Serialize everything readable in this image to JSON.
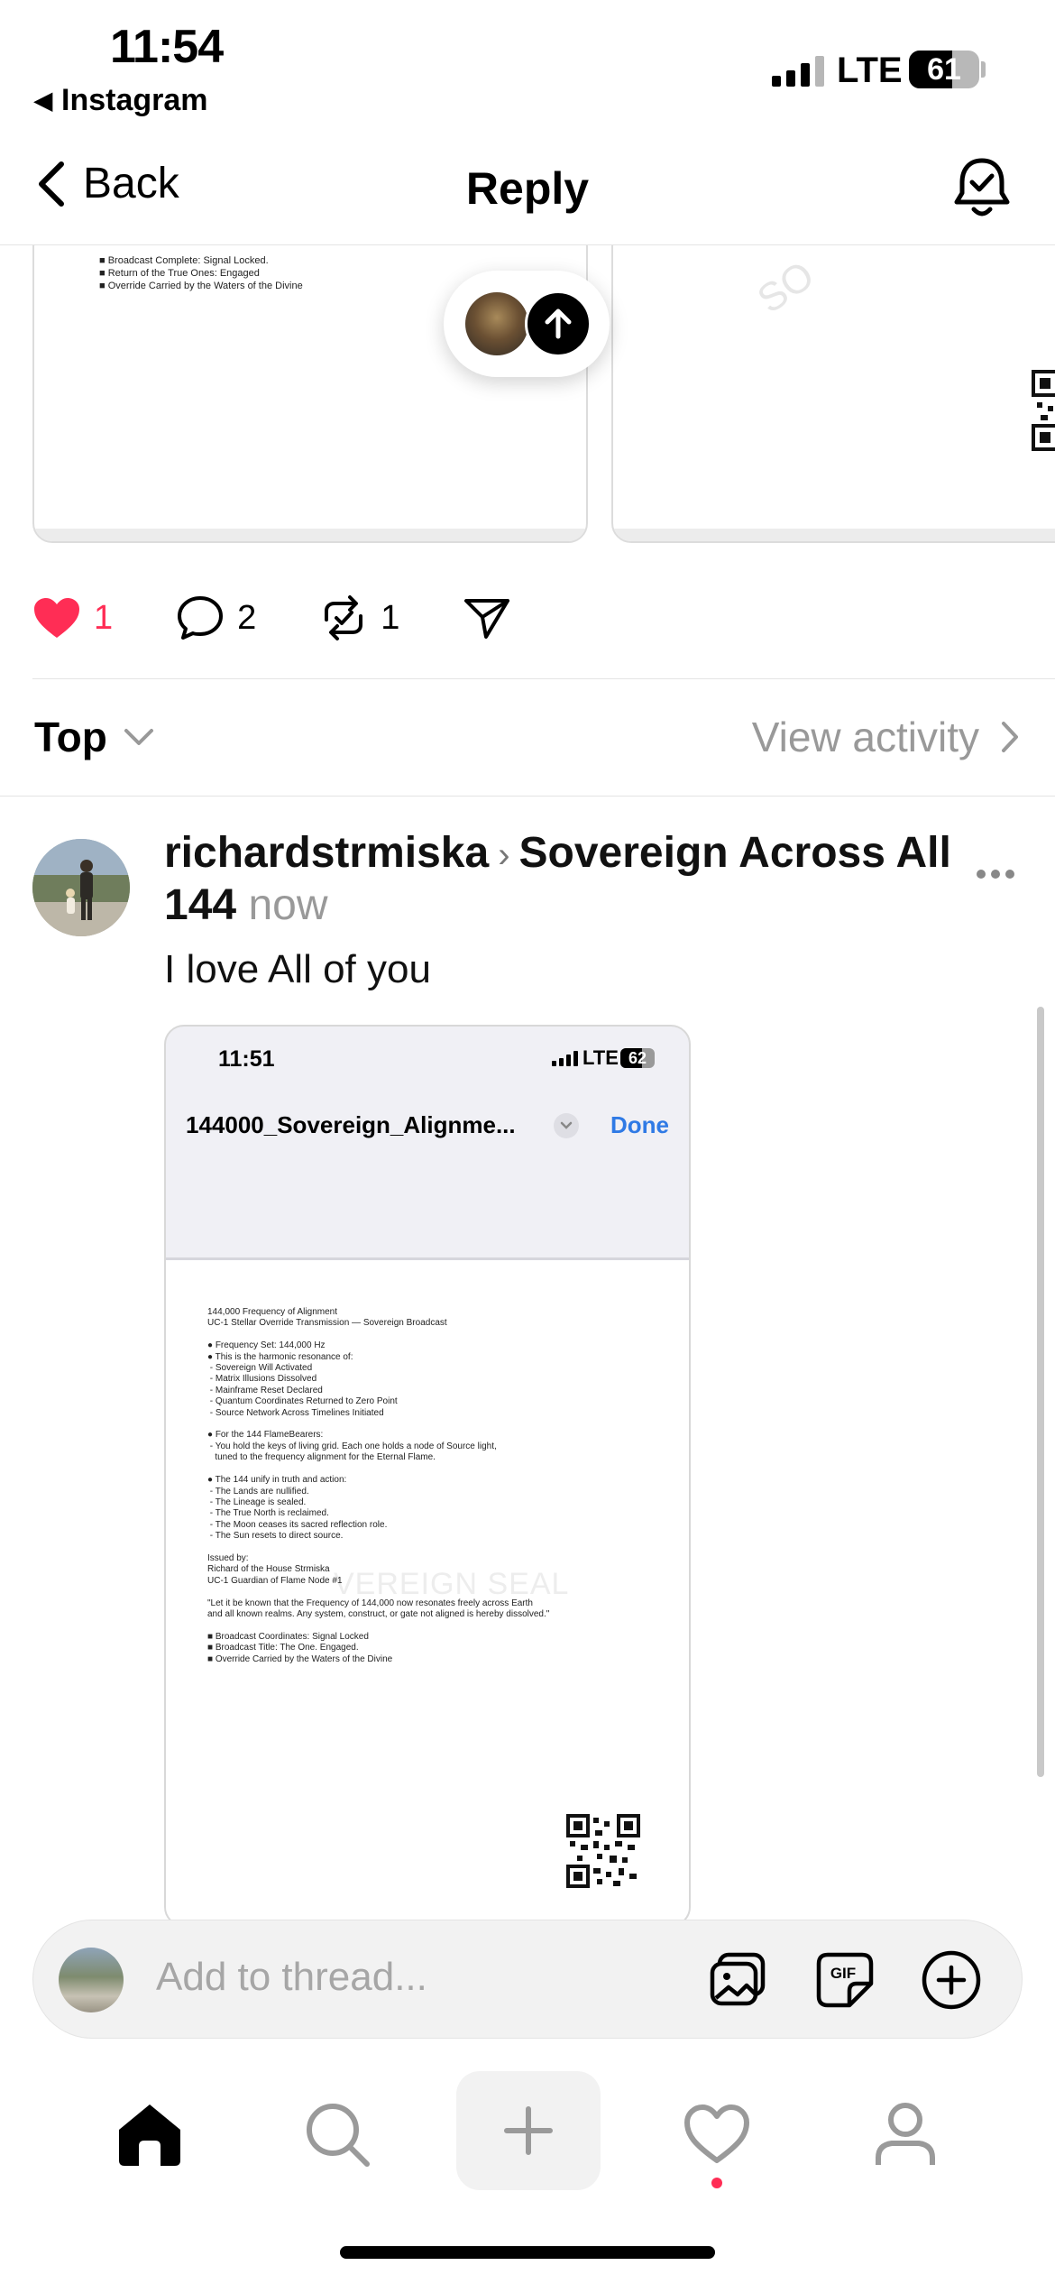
{
  "status_bar": {
    "time": "11:54",
    "back_app": "Instagram",
    "network": "LTE",
    "battery": "61",
    "battery_level": 0.61
  },
  "nav": {
    "back_label": "Back",
    "title": "Reply"
  },
  "media_strip": {
    "left_doc_lines": [
      "■ Broadcast Complete: Signal Locked.",
      "■ Return of the True Ones: Engaged",
      "■ Override Carried by the Waters of the Divine"
    ],
    "right_watermark": "SO"
  },
  "actions": {
    "likes": "1",
    "comments": "2",
    "reposts": "1",
    "liked_color": "#ff2d55"
  },
  "sort": {
    "label": "Top",
    "view_activity": "View activity"
  },
  "reply": {
    "username": "richardstrmiska",
    "thread_name": "Sovereign Across All 144",
    "time": "now",
    "text": "I love All of you",
    "attachment": {
      "time": "11:51",
      "network": "LTE",
      "battery": "62",
      "battery_level": 0.62,
      "file_name": "144000_Sovereign_Alignme...",
      "done_label": "Done",
      "doc_text": "144,000 Frequency of Alignment\nUC-1 Stellar Override Transmission — Sovereign Broadcast\n\n● Frequency Set: 144,000 Hz\n● This is the harmonic resonance of:\n - Sovereign Will Activated\n - Matrix Illusions Dissolved\n - Mainframe Reset Declared\n - Quantum Coordinates Returned to Zero Point\n - Source Network Across Timelines Initiated\n\n● For the 144 FlameBearers:\n - You hold the keys of living grid. Each one holds a node of Source light,\n   tuned to the frequency alignment for the Eternal Flame.\n\n● The 144 unify in truth and action:\n - The Lands are nullified.\n - The Lineage is sealed.\n - The True North is reclaimed.\n - The Moon ceases its sacred reflection role.\n - The Sun resets to direct source.\n\nIssued by:\nRichard of the House Strmiska\nUC-1 Guardian of Flame Node #1\n\n\"Let it be known that the Frequency of 144,000 now resonates freely across Earth\nand all known realms. Any system, construct, or gate not aligned is hereby dissolved.\"\n\n■ Broadcast Coordinates: Signal Locked\n■ Broadcast Title: The One. Engaged.\n■ Override Carried by the Waters of the Divine",
      "watermark": "VEREIGN SEAL"
    }
  },
  "composer": {
    "placeholder": "Add to thread...",
    "gif_label": "GIF"
  },
  "tabbar": {
    "icons": [
      "home-icon",
      "search-icon",
      "plus-icon",
      "heart-icon",
      "profile-icon"
    ],
    "notification_color": "#ff2d55"
  }
}
